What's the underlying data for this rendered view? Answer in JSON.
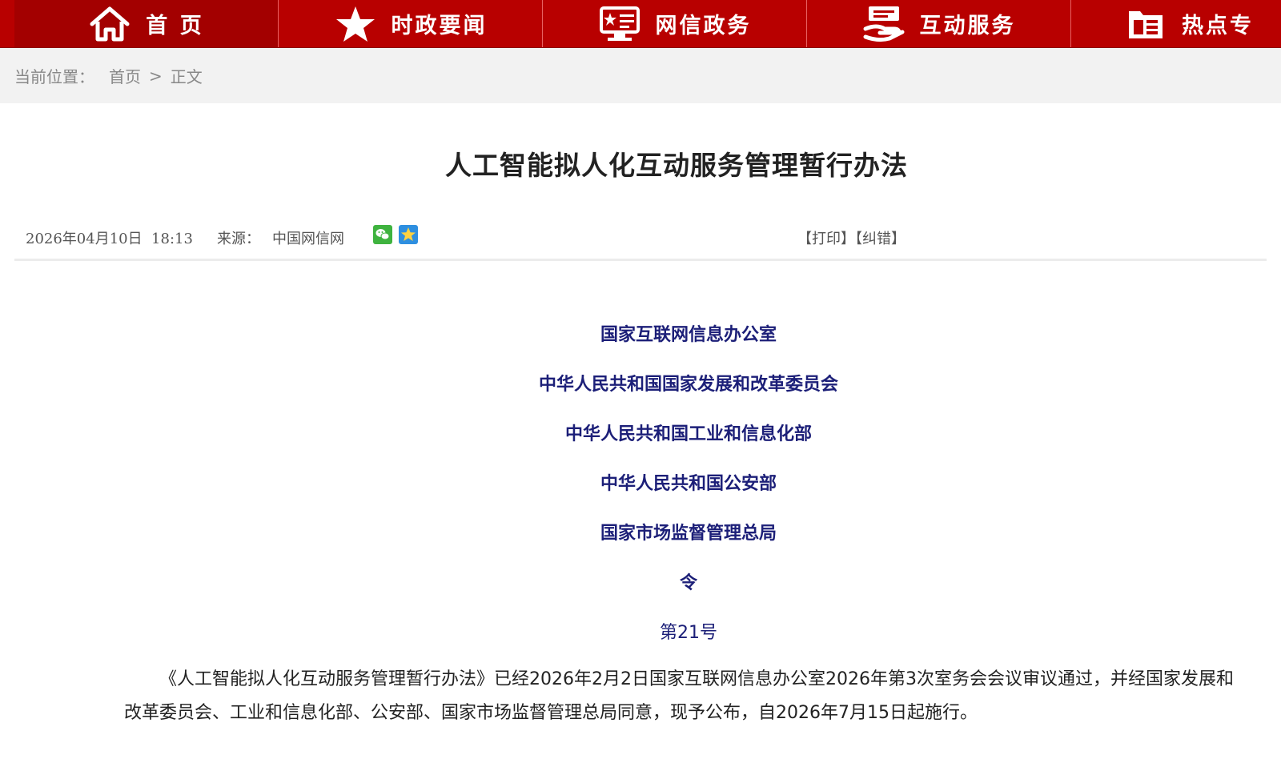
{
  "nav": {
    "items": [
      {
        "label": "首 页",
        "icon": "home-icon"
      },
      {
        "label": "时政要闻",
        "icon": "star-icon"
      },
      {
        "label": "网信政务",
        "icon": "monitor-icon"
      },
      {
        "label": "互动服务",
        "icon": "hand-service-icon"
      },
      {
        "label": "热点专",
        "icon": "folder-icon"
      }
    ],
    "active_index": 0,
    "colors": {
      "background": "#b80000",
      "active": "#a30000",
      "text": "#ffffff"
    }
  },
  "breadcrumb": {
    "label": "当前位置：",
    "home": "首页",
    "arrow": ">",
    "current": "正文"
  },
  "article": {
    "title": "人工智能拟人化互动服务管理暂行办法",
    "date": "2026年04月10日  18:13",
    "source_label": "来源：",
    "source": "中国网信网",
    "print": "【打印】",
    "report_error": "【纠错】",
    "share_icons": [
      "wechat-icon",
      "qzone-icon"
    ],
    "issuers": [
      "国家互联网信息办公室",
      "中华人民共和国国家发展和改革委员会",
      "中华人民共和国工业和信息化部",
      "中华人民共和国公安部",
      "国家市场监督管理总局"
    ],
    "order_label": "令",
    "order_number": "第21号",
    "body": "《人工智能拟人化互动服务管理暂行办法》已经2026年2月2日国家互联网信息办公室2026年第3次室务会会议审议通过，并经国家发展和改革委员会、工业和信息化部、公安部、国家市场监督管理总局同意，现予公布，自2026年7月15日起施行。",
    "issuer_color": "#1c1f78"
  }
}
